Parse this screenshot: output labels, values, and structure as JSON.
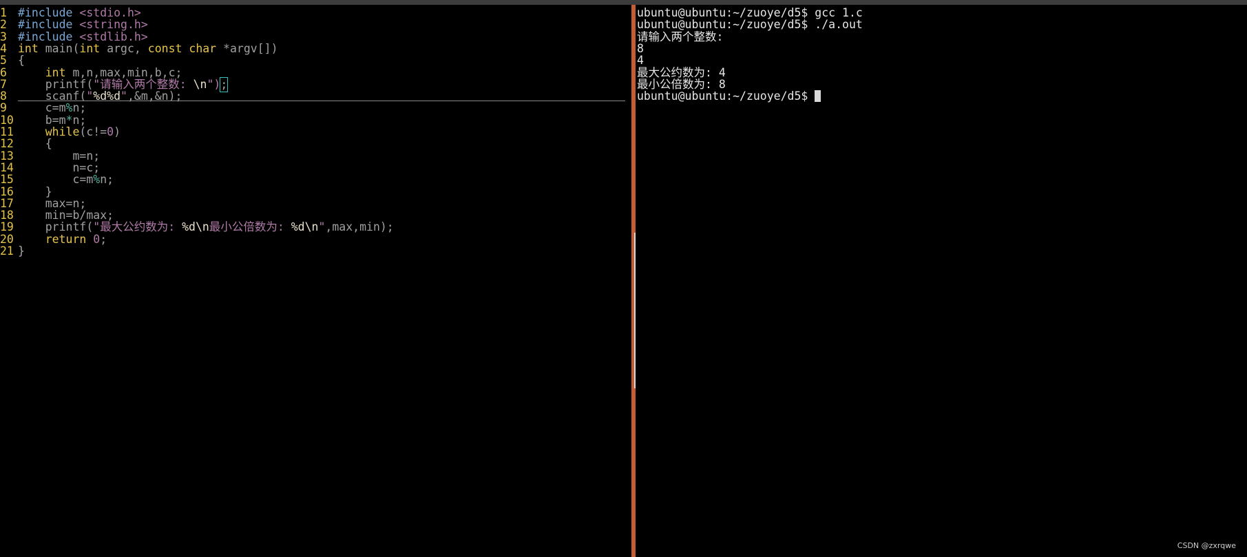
{
  "editor": {
    "lines": [
      {
        "no": "1",
        "tokens": [
          {
            "t": "#include ",
            "c": "pre"
          },
          {
            "t": "<stdio.h>",
            "c": "str"
          }
        ]
      },
      {
        "no": "2",
        "tokens": [
          {
            "t": "#include ",
            "c": "pre"
          },
          {
            "t": "<string.h>",
            "c": "str"
          }
        ]
      },
      {
        "no": "3",
        "tokens": [
          {
            "t": "#include ",
            "c": "pre"
          },
          {
            "t": "<stdlib.h>",
            "c": "str"
          }
        ]
      },
      {
        "no": "4",
        "tokens": [
          {
            "t": "int",
            "c": "kw"
          },
          {
            "t": " main(",
            "c": "id"
          },
          {
            "t": "int",
            "c": "kw"
          },
          {
            "t": " argc, ",
            "c": "id"
          },
          {
            "t": "const char",
            "c": "kw"
          },
          {
            "t": " *argv[])",
            "c": "id"
          }
        ]
      },
      {
        "no": "5",
        "tokens": [
          {
            "t": "{",
            "c": "pun"
          }
        ]
      },
      {
        "no": "6",
        "tokens": [
          {
            "t": "    ",
            "c": "pun"
          },
          {
            "t": "int",
            "c": "kw"
          },
          {
            "t": " m,n,max,min,b,c;",
            "c": "id"
          }
        ]
      },
      {
        "no": "7",
        "tokens": [
          {
            "t": "    printf(",
            "c": "id"
          },
          {
            "t": "\"请输入两个整数: ",
            "c": "str"
          },
          {
            "t": "\\n",
            "c": "esc"
          },
          {
            "t": "\")",
            "c": "str"
          },
          {
            "t": ";",
            "c": "cursor"
          }
        ]
      },
      {
        "no": "8",
        "tokens": [
          {
            "t": "    scanf(",
            "c": "id"
          },
          {
            "t": "\"",
            "c": "str"
          },
          {
            "t": "%d%d",
            "c": "esc"
          },
          {
            "t": "\"",
            "c": "str"
          },
          {
            "t": ",&m,&n);",
            "c": "id"
          }
        ]
      },
      {
        "no": "9",
        "tokens": [
          {
            "t": "    c=m",
            "c": "id"
          },
          {
            "t": "%",
            "c": "op"
          },
          {
            "t": "n;",
            "c": "id"
          }
        ]
      },
      {
        "no": "10",
        "tokens": [
          {
            "t": "    b=m",
            "c": "id"
          },
          {
            "t": "*",
            "c": "op"
          },
          {
            "t": "n;",
            "c": "id"
          }
        ]
      },
      {
        "no": "11",
        "tokens": [
          {
            "t": "    ",
            "c": "pun"
          },
          {
            "t": "while",
            "c": "kw"
          },
          {
            "t": "(c!=",
            "c": "id"
          },
          {
            "t": "0",
            "c": "num"
          },
          {
            "t": ")",
            "c": "id"
          }
        ]
      },
      {
        "no": "12",
        "tokens": [
          {
            "t": "    {",
            "c": "pun"
          }
        ]
      },
      {
        "no": "13",
        "tokens": [
          {
            "t": "        m=n;",
            "c": "id"
          }
        ]
      },
      {
        "no": "14",
        "tokens": [
          {
            "t": "        n=c;",
            "c": "id"
          }
        ]
      },
      {
        "no": "15",
        "tokens": [
          {
            "t": "        c=m",
            "c": "id"
          },
          {
            "t": "%",
            "c": "op"
          },
          {
            "t": "n;",
            "c": "id"
          }
        ]
      },
      {
        "no": "16",
        "tokens": [
          {
            "t": "    }",
            "c": "pun"
          }
        ]
      },
      {
        "no": "17",
        "tokens": [
          {
            "t": "    max=n;",
            "c": "id"
          }
        ]
      },
      {
        "no": "18",
        "tokens": [
          {
            "t": "    min=b/max;",
            "c": "id"
          }
        ]
      },
      {
        "no": "19",
        "tokens": [
          {
            "t": "    printf(",
            "c": "id"
          },
          {
            "t": "\"最大公约数为: ",
            "c": "str"
          },
          {
            "t": "%d\\n",
            "c": "esc"
          },
          {
            "t": "最小公倍数为: ",
            "c": "str"
          },
          {
            "t": "%d\\n",
            "c": "esc"
          },
          {
            "t": "\"",
            "c": "str"
          },
          {
            "t": ",max,min);",
            "c": "id"
          }
        ]
      },
      {
        "no": "20",
        "tokens": [
          {
            "t": "    ",
            "c": "pun"
          },
          {
            "t": "return",
            "c": "kw"
          },
          {
            "t": " ",
            "c": "pun"
          },
          {
            "t": "0",
            "c": "num"
          },
          {
            "t": ";",
            "c": "id"
          }
        ]
      },
      {
        "no": "21",
        "tokens": [
          {
            "t": "}",
            "c": "pun"
          }
        ]
      }
    ]
  },
  "terminal": {
    "lines": [
      "ubuntu@ubuntu:~/zuoye/d5$ gcc 1.c",
      "ubuntu@ubuntu:~/zuoye/d5$ ./a.out",
      "请输入两个整数:",
      "8",
      "4",
      "最大公约数为: 4",
      "最小公倍数为: 8"
    ],
    "prompt": "ubuntu@ubuntu:~/zuoye/d5$ "
  },
  "watermark": "CSDN @zxrqwe"
}
